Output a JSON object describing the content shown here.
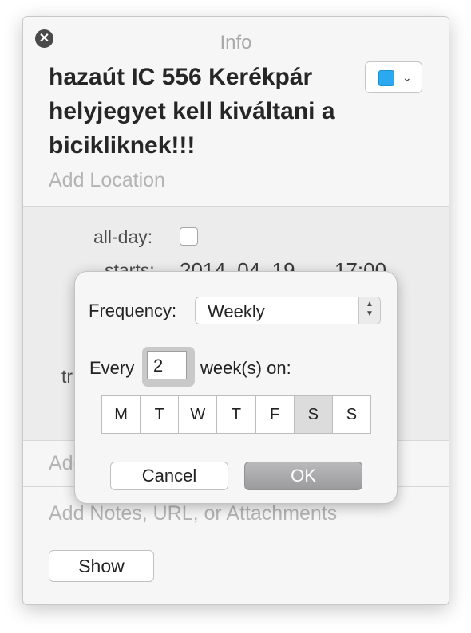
{
  "window": {
    "title": "Info",
    "close_icon": "close-icon"
  },
  "event": {
    "title": "hazaút IC 556 Kerékpár helyjegyet kell kiváltani a bicikliknek!!!",
    "calendar_color": "#2ba9f0",
    "location_placeholder": "Add Location"
  },
  "details": {
    "allday_label": "all-day:",
    "allday_checked": false,
    "starts_label": "starts:",
    "starts_date": "2014. 04. 19.",
    "starts_time": "17:00",
    "repeat_label_partial": "tr"
  },
  "invitees": {
    "placeholder_partial": "Add"
  },
  "notes": {
    "placeholder": "Add Notes, URL, or Attachments"
  },
  "show_button": {
    "label": "Show"
  },
  "recurrence_popover": {
    "frequency_label": "Frequency:",
    "frequency_value": "Weekly",
    "every_label": "Every",
    "every_value": "2",
    "unit_label": "week(s) on:",
    "days": [
      {
        "label": "M",
        "selected": false
      },
      {
        "label": "T",
        "selected": false
      },
      {
        "label": "W",
        "selected": false
      },
      {
        "label": "T",
        "selected": false
      },
      {
        "label": "F",
        "selected": false
      },
      {
        "label": "S",
        "selected": true
      },
      {
        "label": "S",
        "selected": false
      }
    ],
    "cancel_label": "Cancel",
    "ok_label": "OK"
  }
}
